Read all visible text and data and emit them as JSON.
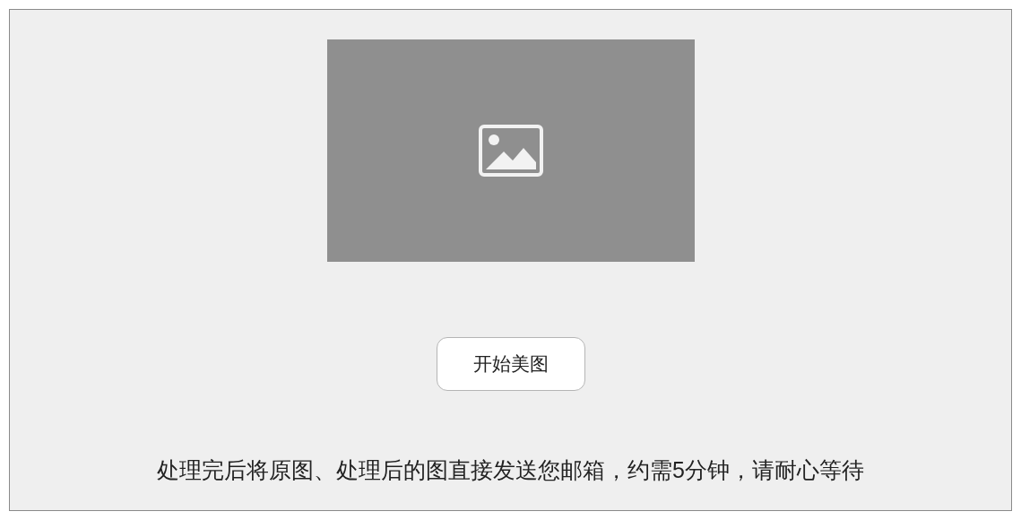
{
  "preview": {
    "kind": "placeholder"
  },
  "start_button": {
    "label": "开始美图"
  },
  "notice": "处理完后将原图、处理后的图直接发送您邮箱，约需5分钟，请耐心等待"
}
